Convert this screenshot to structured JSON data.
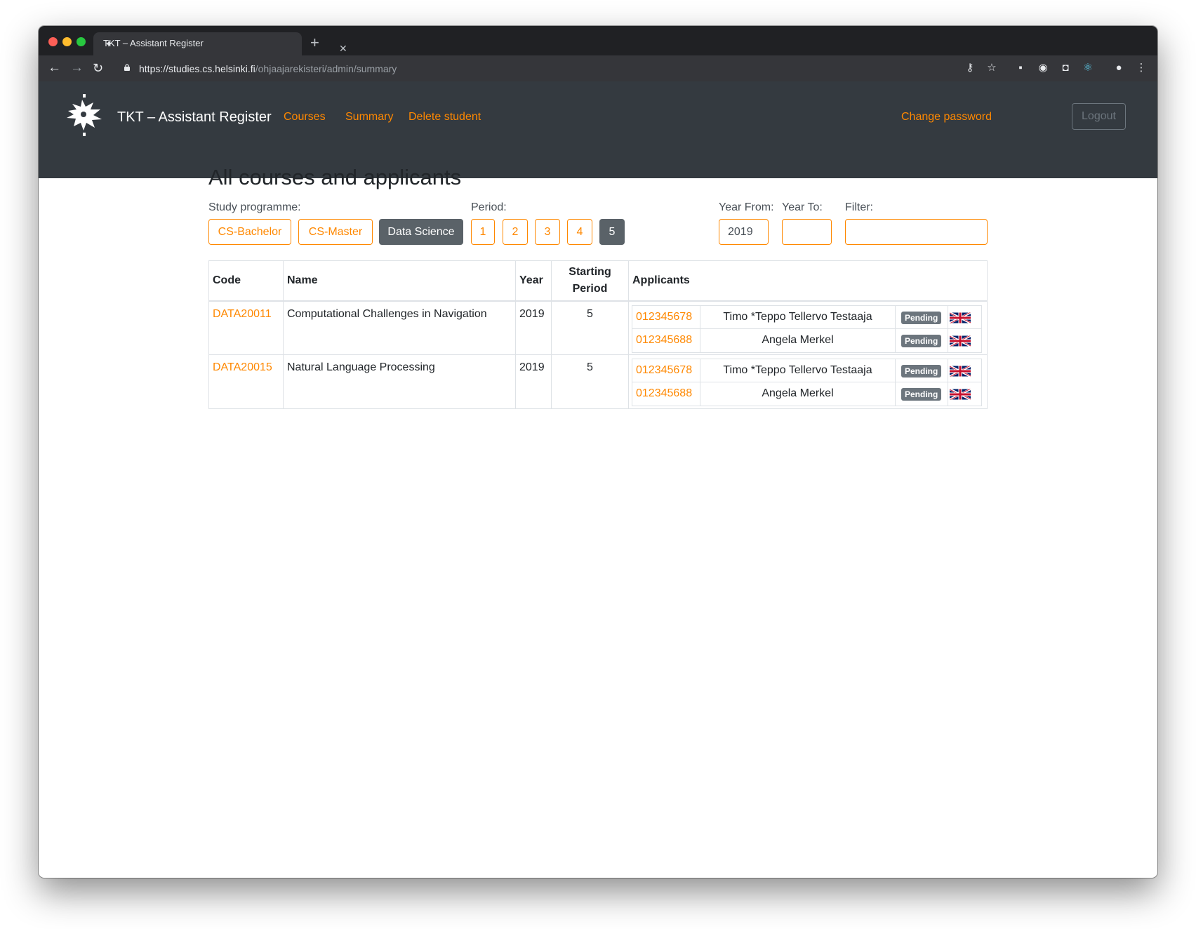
{
  "browser": {
    "tab_title": "TKT – Assistant Register",
    "url_host": "https://studies.cs.helsinki.fi",
    "url_path": "/ohjaajarekisteri/admin/summary"
  },
  "navbar": {
    "brand": "TKT – Assistant Register",
    "links": [
      "Courses",
      "Summary",
      "Delete student"
    ],
    "change_password": "Change password",
    "logout": "Logout",
    "accent_color": "#ff8800",
    "background_color": "#343a40"
  },
  "page": {
    "title": "All courses and applicants",
    "filters": {
      "study_programme_label": "Study programme:",
      "programmes": [
        {
          "label": "CS-Bachelor",
          "active": false
        },
        {
          "label": "CS-Master",
          "active": false
        },
        {
          "label": "Data Science",
          "active": true
        }
      ],
      "period_label": "Period:",
      "periods": [
        {
          "label": "1",
          "active": false
        },
        {
          "label": "2",
          "active": false
        },
        {
          "label": "3",
          "active": false
        },
        {
          "label": "4",
          "active": false
        },
        {
          "label": "5",
          "active": true
        }
      ],
      "year_from_label": "Year From:",
      "year_from_value": "2019",
      "year_to_label": "Year To:",
      "year_to_value": "",
      "filter_label": "Filter:",
      "filter_value": ""
    },
    "table": {
      "headers": {
        "code": "Code",
        "name": "Name",
        "year": "Year",
        "period": "Starting Period",
        "applicants": "Applicants"
      },
      "rows": [
        {
          "code": "DATA20011",
          "name": "Computational Challenges in Navigation",
          "year": "2019",
          "period": "5",
          "applicants": [
            {
              "student_number": "012345678",
              "name": "Timo *Teppo Tellervo Testaaja",
              "status": "Pending",
              "language_icon": "uk-flag-icon"
            },
            {
              "student_number": "012345688",
              "name": "Angela Merkel",
              "status": "Pending",
              "language_icon": "uk-flag-icon"
            }
          ]
        },
        {
          "code": "DATA20015",
          "name": "Natural Language Processing",
          "year": "2019",
          "period": "5",
          "applicants": [
            {
              "student_number": "012345678",
              "name": "Timo *Teppo Tellervo Testaaja",
              "status": "Pending",
              "language_icon": "uk-flag-icon"
            },
            {
              "student_number": "012345688",
              "name": "Angela Merkel",
              "status": "Pending",
              "language_icon": "uk-flag-icon"
            }
          ]
        }
      ]
    }
  }
}
